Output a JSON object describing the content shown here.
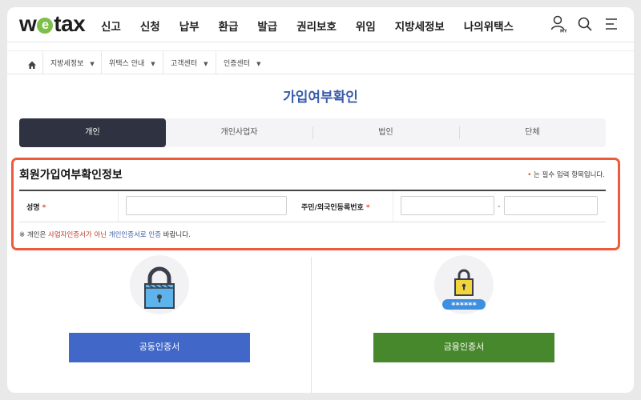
{
  "logo": {
    "pre": "w",
    "mid": "e",
    "post": "tax"
  },
  "nav": [
    "신고",
    "신청",
    "납부",
    "환급",
    "발급",
    "권리보호",
    "위임",
    "지방세정보",
    "나의위택스"
  ],
  "header_icons": [
    "user-my-icon",
    "search-icon",
    "menu-icon"
  ],
  "my_label": "MY",
  "breadcrumb": {
    "home_icon": "home-icon",
    "items": [
      "지방세정보",
      "위택스 안내",
      "고객센터",
      "인증센터"
    ]
  },
  "page_title": "가입여부확인",
  "tabs": [
    "개인",
    "개인사업자",
    "법인",
    "단체"
  ],
  "active_tab": 0,
  "form": {
    "title": "회원가입여부확인정보",
    "required_note_dot": "•",
    "required_note": "는 필수 입력 항목입니다.",
    "name_label": "성명",
    "id_label": "주민/외국인등록번호",
    "star": "*",
    "name_value": "",
    "id_front_value": "",
    "id_back_value": "",
    "dash": "-",
    "notice_prefix": "※  개인은 ",
    "notice_red": "사업자인증서가 아닌",
    "notice_blue": " 개인인증서로 인증",
    "notice_suffix": " 바랍니다."
  },
  "certs": {
    "joint_label": "공동인증서",
    "financial_label": "금융인증서",
    "password_mask": "******"
  },
  "colors": {
    "accent_blue": "#3b5ca8",
    "active_tab_bg": "#2f3240",
    "highlight_border": "#ee5a3c",
    "joint_button": "#4168c9",
    "financial_button": "#46882b",
    "required_red": "#e24c2a"
  }
}
